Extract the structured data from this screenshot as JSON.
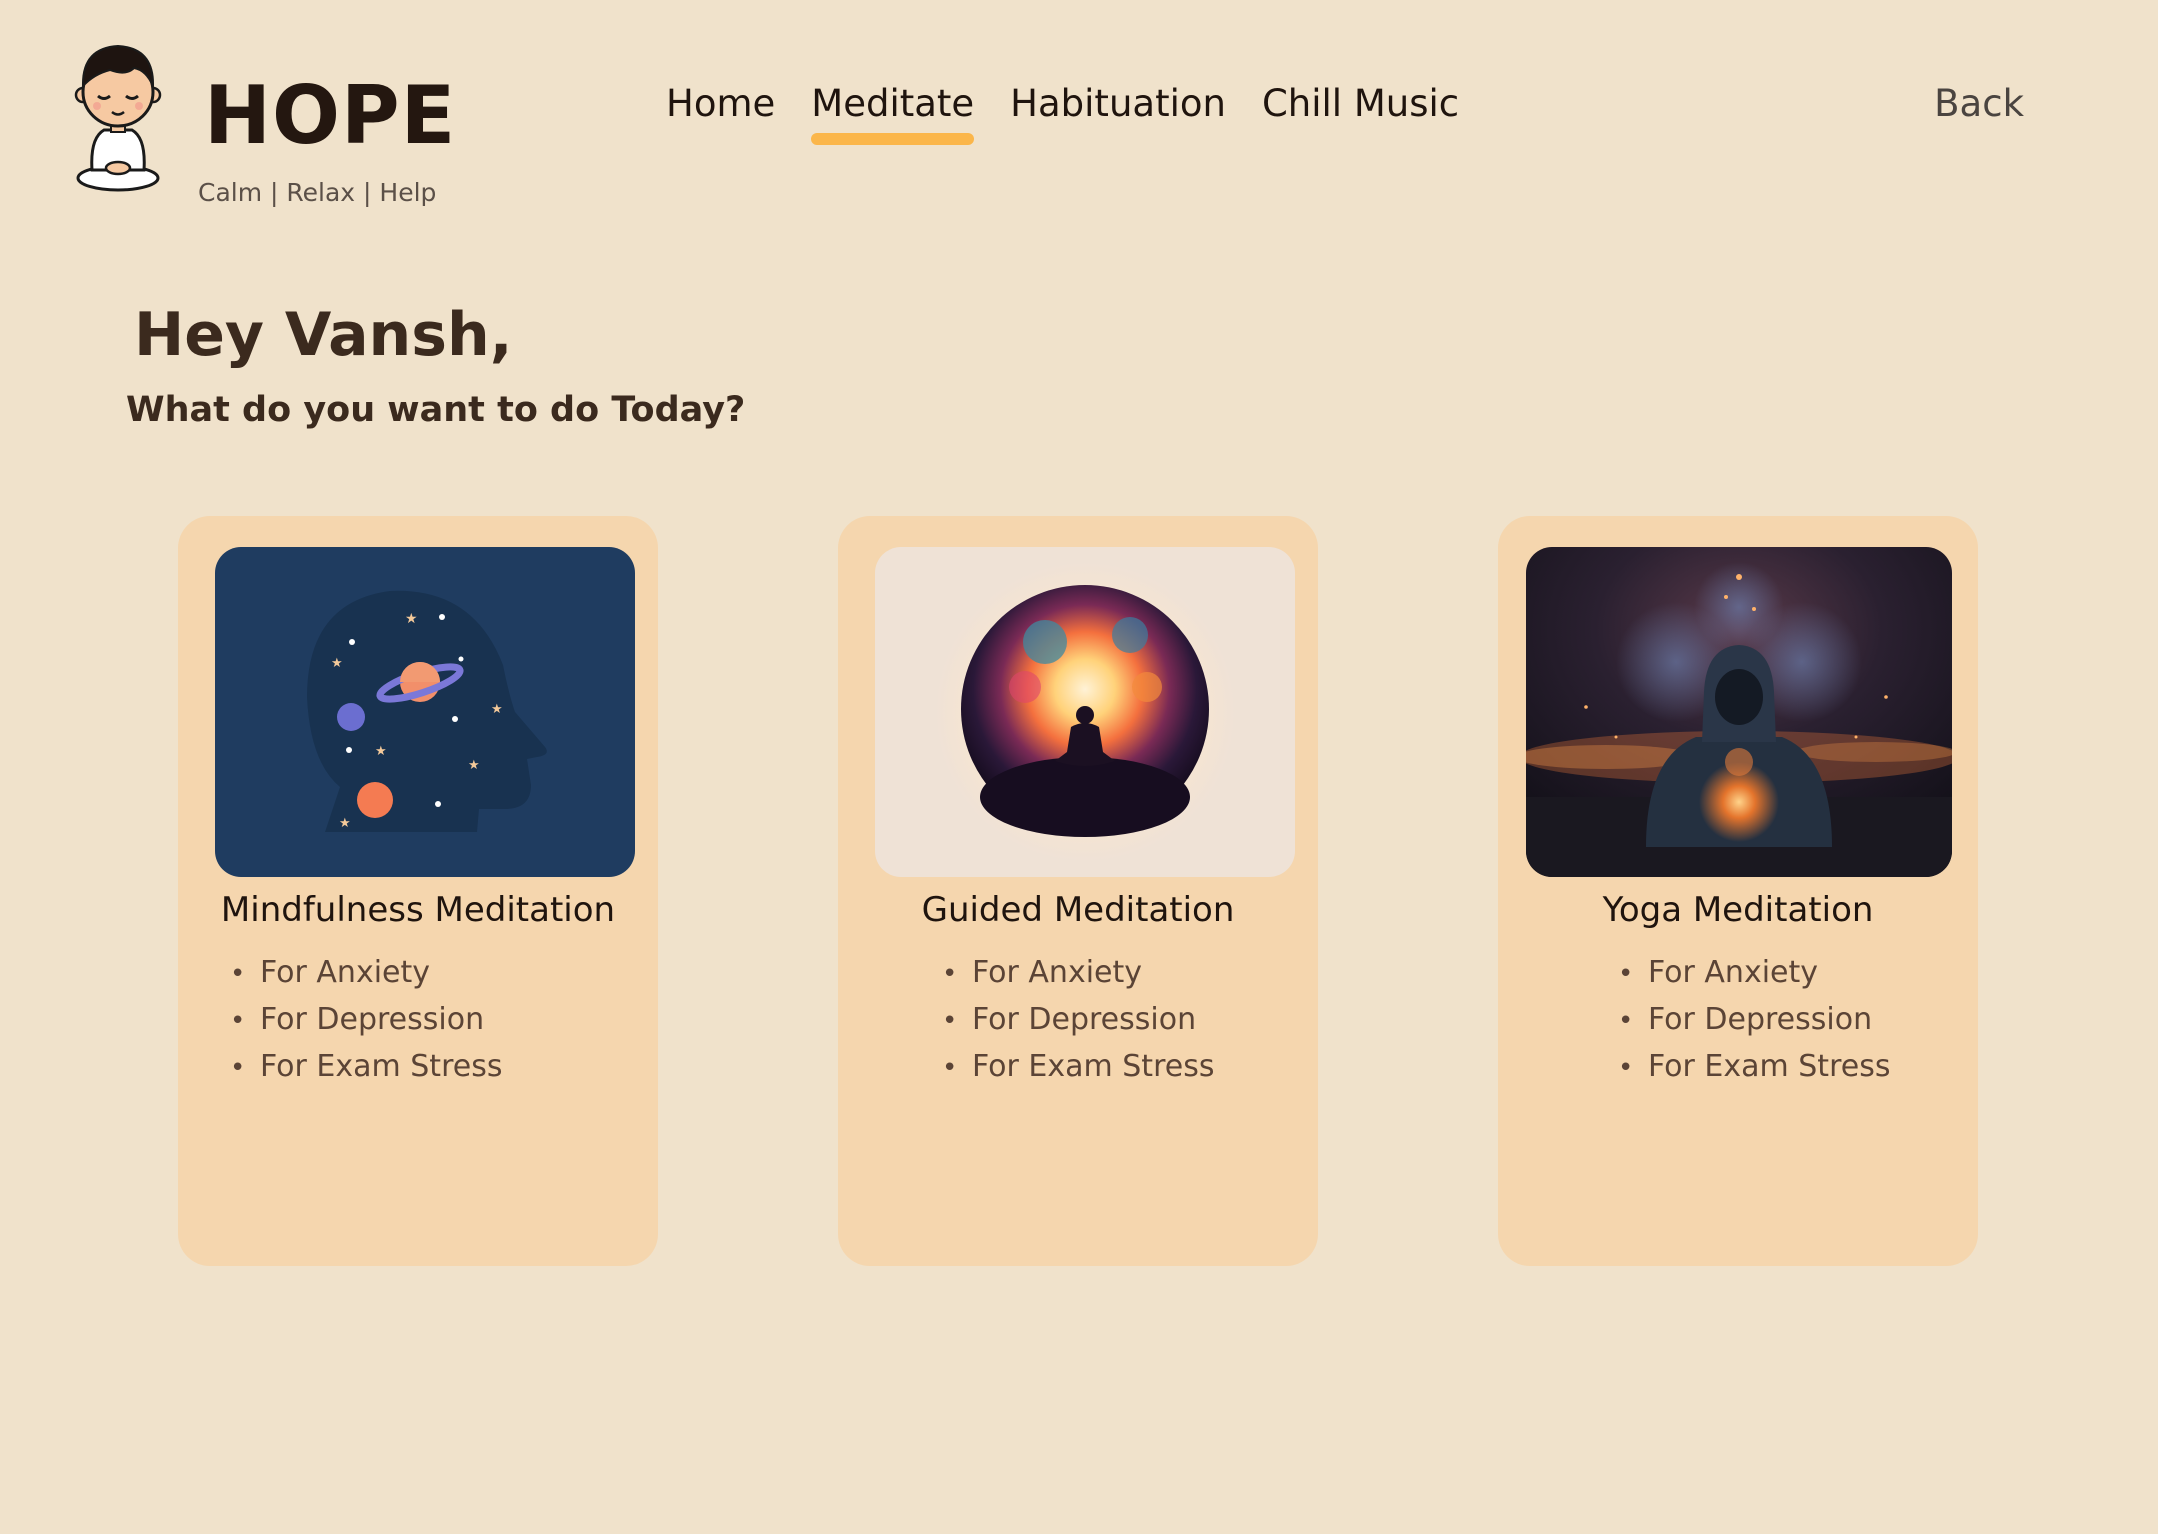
{
  "theme": {
    "background": "#f0e2cb",
    "card_background": "#f5d6ae",
    "accent": "#fbb64a",
    "text_dark": "#2b1d14"
  },
  "brand": {
    "name": "HOPE",
    "tagline": "Calm | Relax | Help",
    "logo_icon": "meditating-boy-mascot"
  },
  "nav": {
    "items": [
      {
        "label": "Home",
        "active": false
      },
      {
        "label": "Meditate",
        "active": true
      },
      {
        "label": "Habituation",
        "active": false
      },
      {
        "label": "Chill Music",
        "active": false
      }
    ],
    "back_label": "Back"
  },
  "greeting": {
    "title": "Hey Vansh,",
    "subtitle": "What do you want to do Today?"
  },
  "cards": [
    {
      "title": "Mindfulness Meditation",
      "image_icon": "space-head-illustration",
      "bullet": "•",
      "items": [
        "For Anxiety",
        "For Depression",
        "For Exam Stress"
      ]
    },
    {
      "title": "Guided Meditation",
      "image_icon": "cosmic-meditation-illustration",
      "bullet": "•",
      "items": [
        "For Anxiety",
        "For Depression",
        "For Exam Stress"
      ]
    },
    {
      "title": "Yoga Meditation",
      "image_icon": "glowing-monk-illustration",
      "bullet": "•",
      "items": [
        "For Anxiety",
        "For Depression",
        "For Exam Stress"
      ]
    }
  ]
}
